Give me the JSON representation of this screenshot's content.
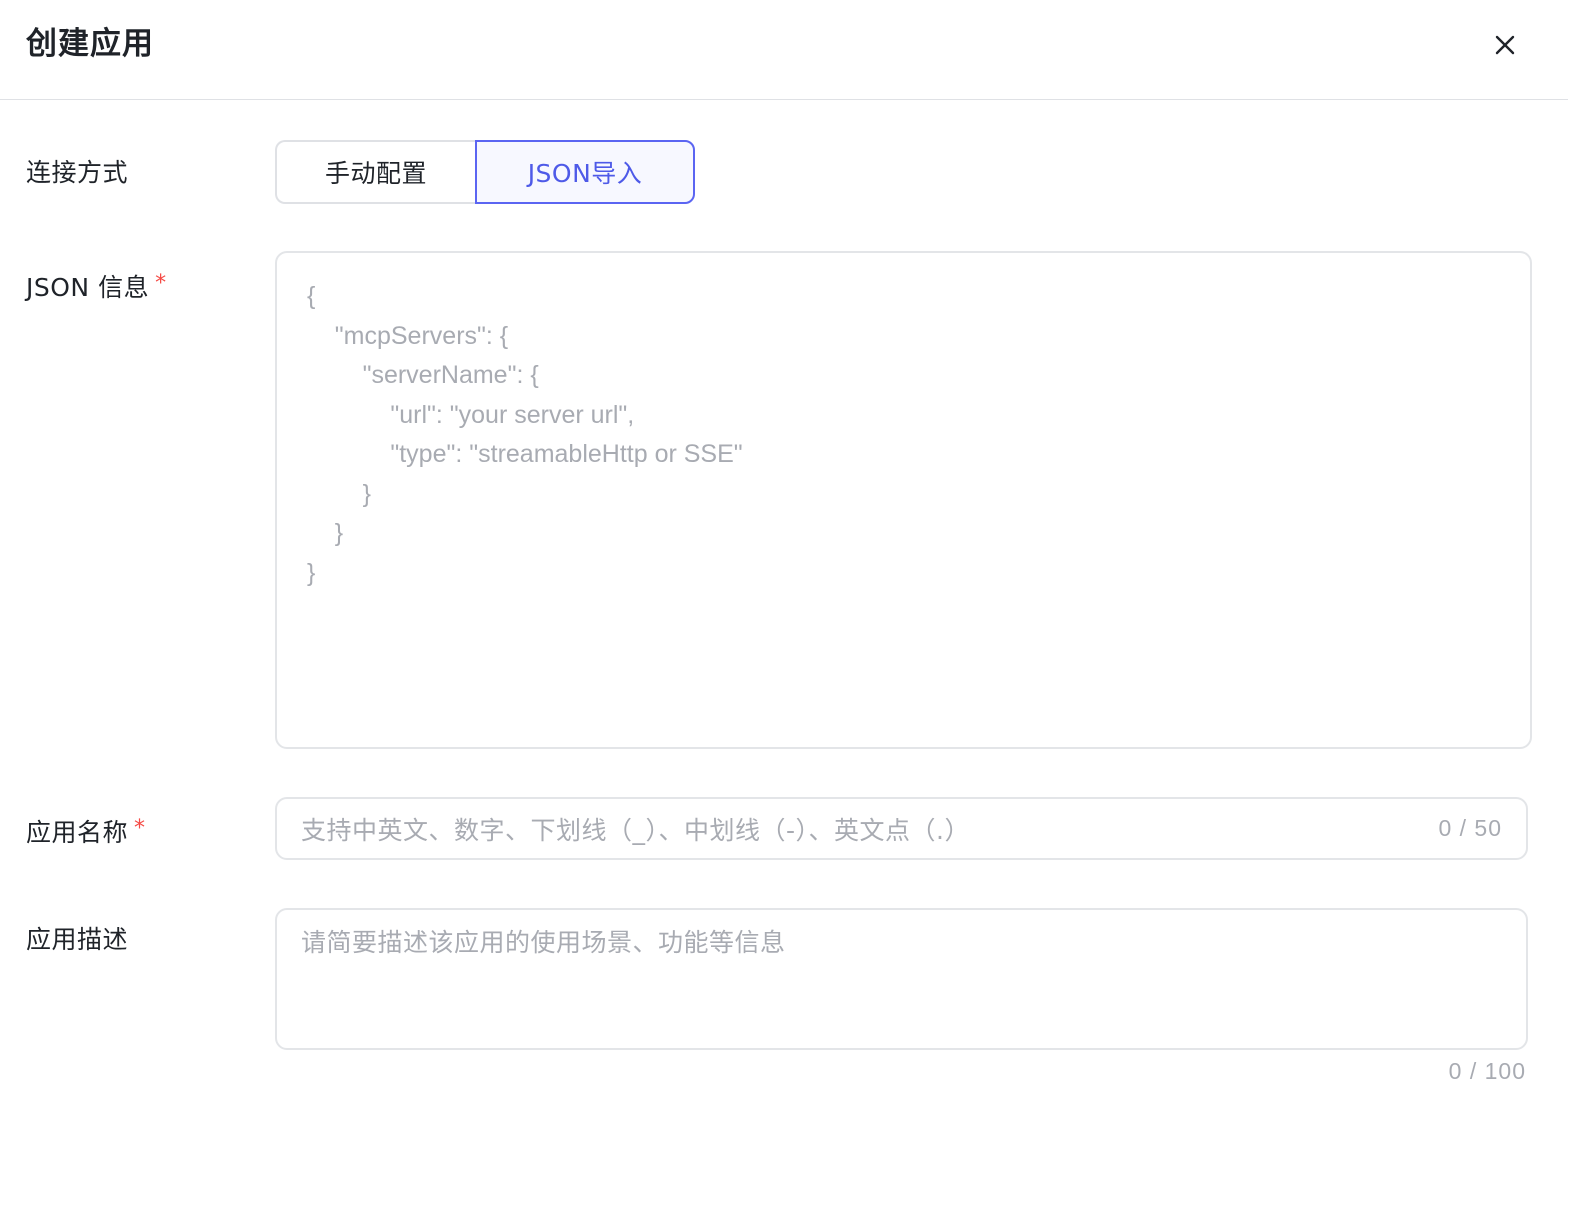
{
  "dialog": {
    "title": "创建应用",
    "close_icon": "close-icon"
  },
  "form": {
    "connection": {
      "label": "连接方式",
      "options": [
        "手动配置",
        "JSON导入"
      ],
      "selected": "JSON导入"
    },
    "json_info": {
      "label": "JSON 信息",
      "required": "*",
      "placeholder_lines": [
        "{",
        "    \"mcpServers\": {",
        "        \"serverName\": {",
        "            \"url\": \"your server url\",",
        "            \"type\": \"streamableHttp or SSE\"",
        "        }",
        "    }",
        "}"
      ]
    },
    "app_name": {
      "label": "应用名称",
      "required": "*",
      "placeholder": "支持中英文、数字、下划线（_）、中划线（-）、英文点（.）",
      "value": "",
      "counter": "0 / 50"
    },
    "app_desc": {
      "label": "应用描述",
      "placeholder": "请简要描述该应用的使用场景、功能等信息",
      "value": "",
      "counter": "0 / 100"
    }
  },
  "colors": {
    "accent": "#4e5ae8",
    "required": "#f54a45",
    "placeholder": "#a8abb2",
    "border": "#dfe1e5"
  }
}
